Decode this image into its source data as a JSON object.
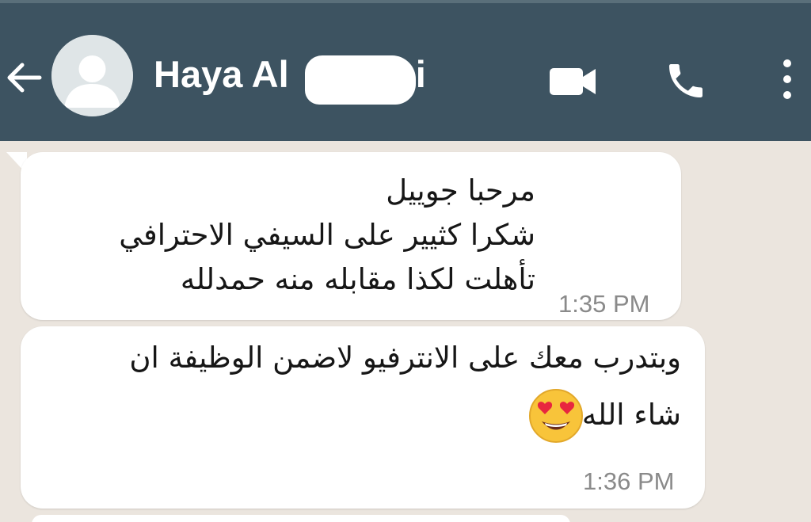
{
  "header": {
    "contact_name": "Haya Al",
    "contact_name_tail": "i",
    "background_color": "#3d5361"
  },
  "icons": {
    "back": "arrow-left-icon",
    "avatar": "default-avatar-icon",
    "video": "video-camera-icon",
    "call": "phone-icon",
    "menu": "more-vertical-icon",
    "emoji": "heart-eyes-emoji-icon"
  },
  "messages": [
    {
      "lines": [
        "مرحبا جوييل",
        "شكرا كثيير على السيفي  الاحترافي",
        "تأهلت لكذا مقابله منه حمدلله"
      ],
      "time": "1:35 PM"
    },
    {
      "lines": [
        "وبتدرب معك على الانترفيو لاضمن الوظيفة ان",
        "شاء الله"
      ],
      "time": "1:36 PM"
    }
  ]
}
